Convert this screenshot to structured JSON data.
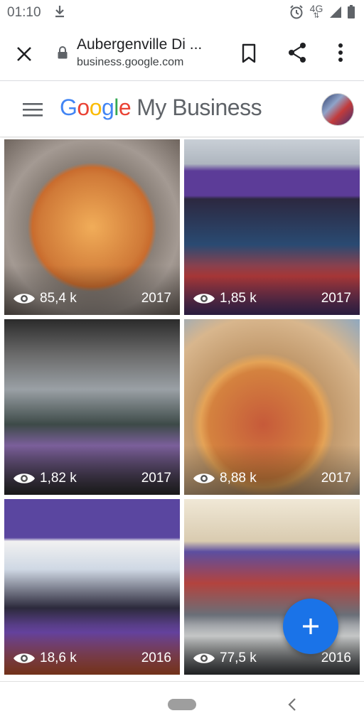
{
  "status_bar": {
    "time": "01:10",
    "network": "4G",
    "icons": [
      "download-icon",
      "alarm-icon",
      "signal-icon",
      "battery-icon"
    ]
  },
  "browser": {
    "page_title": "Aubergenville Di ...",
    "url_host": "business.google.com",
    "icons": [
      "close-icon",
      "lock-icon",
      "bookmark-icon",
      "share-icon",
      "more-vert-icon"
    ]
  },
  "app_header": {
    "logo_letters": [
      "G",
      "o",
      "o",
      "g",
      "l",
      "e"
    ],
    "product_name": "My Business",
    "icons": [
      "menu-icon",
      "avatar"
    ]
  },
  "photos": [
    {
      "views": "85,4 k",
      "year": "2017"
    },
    {
      "views": "1,85 k",
      "year": "2017"
    },
    {
      "views": "1,82 k",
      "year": "2017"
    },
    {
      "views": "8,88 k",
      "year": "2017"
    },
    {
      "views": "18,6 k",
      "year": "2016"
    },
    {
      "views": "77,5 k",
      "year": "2016"
    }
  ],
  "fab": {
    "icon": "plus-icon"
  },
  "colors": {
    "google_blue": "#4285f4",
    "google_red": "#ea4335",
    "google_yellow": "#fbbc05",
    "google_green": "#34a853",
    "fab_blue": "#1a73e8",
    "text_dark": "#202124",
    "text_muted": "#5f6368"
  }
}
